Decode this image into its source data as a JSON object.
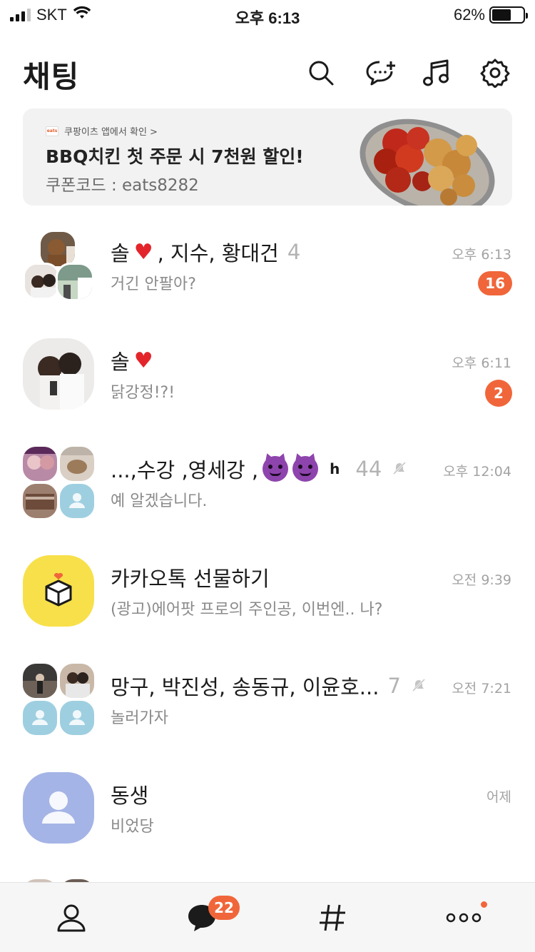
{
  "status_bar": {
    "carrier": "SKT",
    "time": "오후 6:13",
    "battery": "62%",
    "battery_level": 0.62
  },
  "header": {
    "title": "채팅",
    "icons": [
      "search-icon",
      "new-chat-icon",
      "music-icon",
      "settings-icon"
    ]
  },
  "ad": {
    "source": "쿠팡이츠 앱에서 확인 >",
    "logo_text": "eats",
    "title": "BBQ치킨 첫 주문 시 7천원 할인!",
    "subtitle": "쿠폰코드 : eats8282"
  },
  "chats": [
    {
      "name_prefix": "솔",
      "name_suffix": ", 지수, 황대건",
      "member_count": "4",
      "message": "거긴 안팔아?",
      "time": "오후 6:13",
      "unread": "16"
    },
    {
      "name_prefix": "솔",
      "message": "닭강정!?!",
      "time": "오후 6:11",
      "unread": "2"
    },
    {
      "name_prefix": "...,수강 ,영세강 ,",
      "name_tail": "h",
      "member_count": "44",
      "message": "예 알겠습니다.",
      "time": "오후 12:04",
      "muted": true
    },
    {
      "name": "카카오톡 선물하기",
      "message": "(광고)에어팟 프로의 주인공, 이번엔.. 나?",
      "time": "오전 9:39"
    },
    {
      "name": "망구, 박진성, 송동규, 이윤호...",
      "member_count": "7",
      "message": "놀러가자",
      "time": "오전 7:21",
      "muted": true
    },
    {
      "name": "동생",
      "message": "비었당",
      "time": "어제"
    }
  ],
  "tab_bar": {
    "tabs": [
      "friends-tab",
      "chats-tab",
      "openchat-tab",
      "more-tab"
    ],
    "chats_badge": "22"
  },
  "colors": {
    "accent": "#f0663a",
    "gift_yellow": "#f7e04a",
    "default_avatar": "#a5b4e6",
    "small_default_avatar": "#9ecfe0"
  }
}
